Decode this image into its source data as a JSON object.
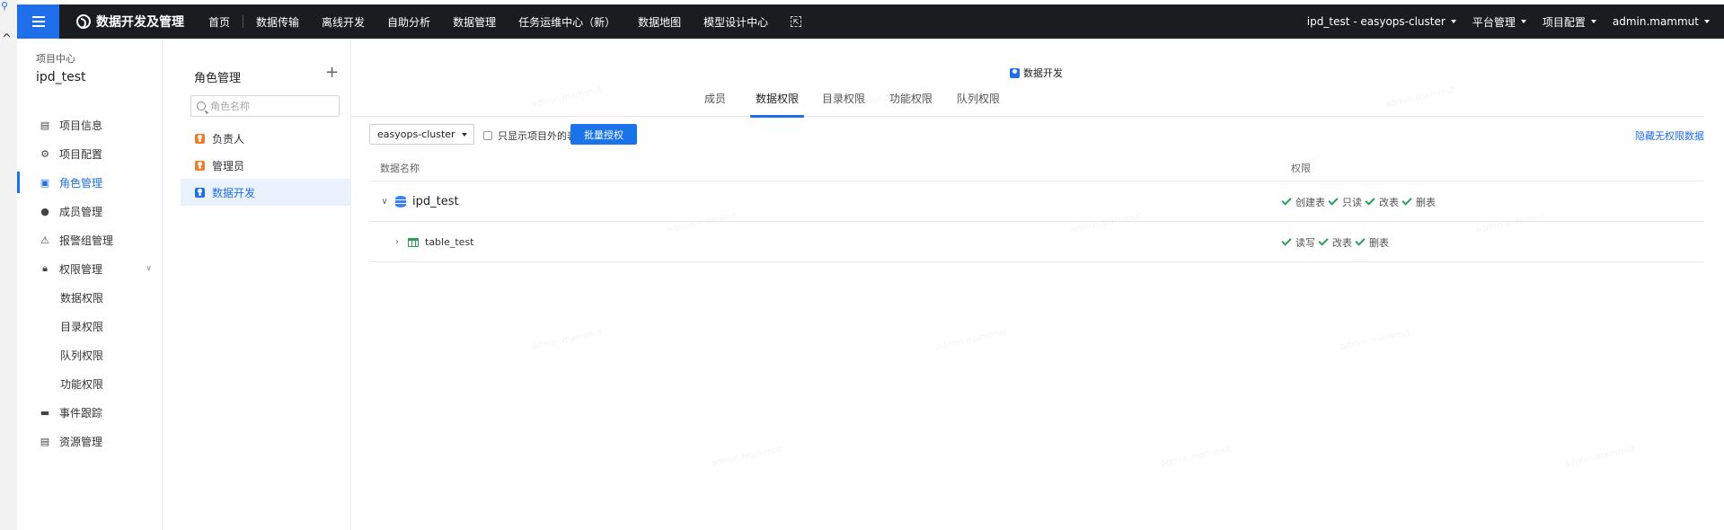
{
  "topbar": {
    "brand_title": "数据开发及管理",
    "nav": [
      "首页",
      "数据传输",
      "离线开发",
      "自助分析",
      "数据管理",
      "任务运维中心（新）",
      "数据地图",
      "模型设计中心"
    ],
    "cluster_selector": "ipd_test - easyops-cluster",
    "platform_menu": "平台管理",
    "project_config_menu": "项目配置",
    "user_menu": "admin.mammut"
  },
  "sidebar": {
    "project_center_label": "项目中心",
    "project_name": "ipd_test",
    "items": [
      {
        "label": "项目信息",
        "icon": "document-icon"
      },
      {
        "label": "项目配置",
        "icon": "gear-icon"
      },
      {
        "label": "角色管理",
        "icon": "role-icon",
        "active": true
      },
      {
        "label": "成员管理",
        "icon": "user-icon"
      },
      {
        "label": "报警组管理",
        "icon": "alarm-icon"
      },
      {
        "label": "权限管理",
        "icon": "lock-icon"
      },
      {
        "label": "数据权限"
      },
      {
        "label": "目录权限"
      },
      {
        "label": "队列权限"
      },
      {
        "label": "功能权限"
      },
      {
        "label": "事件跟踪",
        "icon": "event-icon"
      },
      {
        "label": "资源管理",
        "icon": "server-icon"
      }
    ]
  },
  "role_panel": {
    "title": "角色管理",
    "search_placeholder": "角色名称",
    "roles": [
      "负责人",
      "管理员",
      "数据开发"
    ],
    "active_role": "数据开发"
  },
  "main": {
    "role_title": "数据开发",
    "tabs": [
      "成员",
      "数据权限",
      "目录权限",
      "功能权限",
      "队列权限"
    ],
    "active_tab": "数据权限",
    "cluster_select_value": "easyops-cluster",
    "checkbox_label": "只显示项目外的表",
    "batch_button": "批量授权",
    "hide_link": "隐藏无权限数据",
    "table": {
      "headers": [
        "数据名称",
        "权限"
      ],
      "rows": [
        {
          "name": "ipd_test",
          "type": "database",
          "expanded": true,
          "perms": [
            "创建表",
            "只读",
            "改表",
            "删表"
          ]
        },
        {
          "name": "table_test",
          "type": "table",
          "expanded": false,
          "perms": [
            "读写",
            "改表",
            "删表"
          ]
        }
      ]
    },
    "watermark": "admin.mammut"
  },
  "colors": {
    "accent": "#1f6feb",
    "topbar": "#1a1c20",
    "check": "#2e9e5b",
    "role_icon": "#f07d28"
  }
}
